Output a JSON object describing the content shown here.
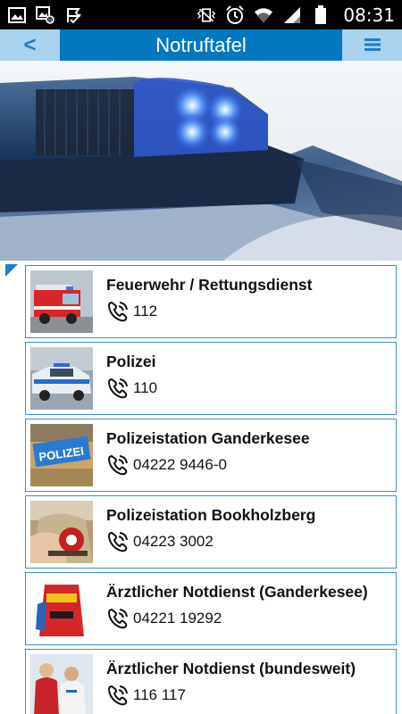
{
  "status_bar": {
    "time": "08:31",
    "left_icons": [
      "gallery-icon",
      "image-at-icon",
      "check-flag-icon"
    ],
    "right_icons": [
      "vibrate-icon",
      "alarm-icon",
      "wifi-icon",
      "signal-icon",
      "battery-icon"
    ]
  },
  "app_bar": {
    "back_label": "<",
    "title": "Notruftafel",
    "menu_icon": "hamburger-menu-icon"
  },
  "hero": {
    "image": "police-car-blue-light"
  },
  "contacts": [
    {
      "title": "Feuerwehr / Rettungsdienst",
      "phone": "112",
      "thumb": "fire-truck"
    },
    {
      "title": "Polizei",
      "phone": "110",
      "thumb": "police-car"
    },
    {
      "title": "Polizeistation Ganderkesee",
      "phone": "04222 9446-0",
      "thumb": "polizei-sign"
    },
    {
      "title": "Polizeistation Bookholzberg",
      "phone": "04223 3002",
      "thumb": "police-officer"
    },
    {
      "title": "Ärztlicher Notdienst (Ganderkesee)",
      "phone": "04221 19292",
      "thumb": "medic-bag"
    },
    {
      "title": "Ärztlicher Notdienst (bundesweit)",
      "phone": "116 117",
      "thumb": "doctors"
    }
  ],
  "colors": {
    "primary": "#0079bf",
    "nav_button_bg": "#a9d3ee",
    "card_border": "#3b8fd0"
  }
}
